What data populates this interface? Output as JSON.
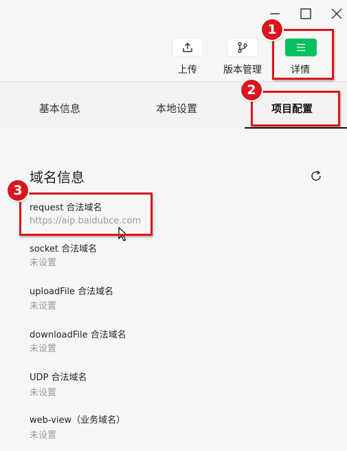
{
  "window_controls": {
    "minimize_icon": "minimize-icon",
    "maximize_icon": "maximize-icon",
    "close_icon": "close-icon"
  },
  "toolbar": {
    "upload_label": "上传",
    "version_label": "版本管理",
    "details_label": "详情",
    "accent_color": "#07c160"
  },
  "tabs": [
    {
      "label": "基本信息"
    },
    {
      "label": "本地设置"
    },
    {
      "label": "项目配置",
      "active": true
    }
  ],
  "domain_section": {
    "title": "域名信息",
    "items": [
      {
        "label": "request 合法域名",
        "value": "https://aip.baidubce.com"
      },
      {
        "label": "socket 合法域名",
        "value": "未设置"
      },
      {
        "label": "uploadFile 合法域名",
        "value": "未设置"
      },
      {
        "label": "downloadFile 合法域名",
        "value": "未设置"
      },
      {
        "label": "UDP 合法域名",
        "value": "未设置"
      },
      {
        "label": "web-view（业务域名）",
        "value": "未设置"
      }
    ]
  },
  "annotations": {
    "color": "#d9161c",
    "badges": [
      "1",
      "2",
      "3"
    ]
  }
}
